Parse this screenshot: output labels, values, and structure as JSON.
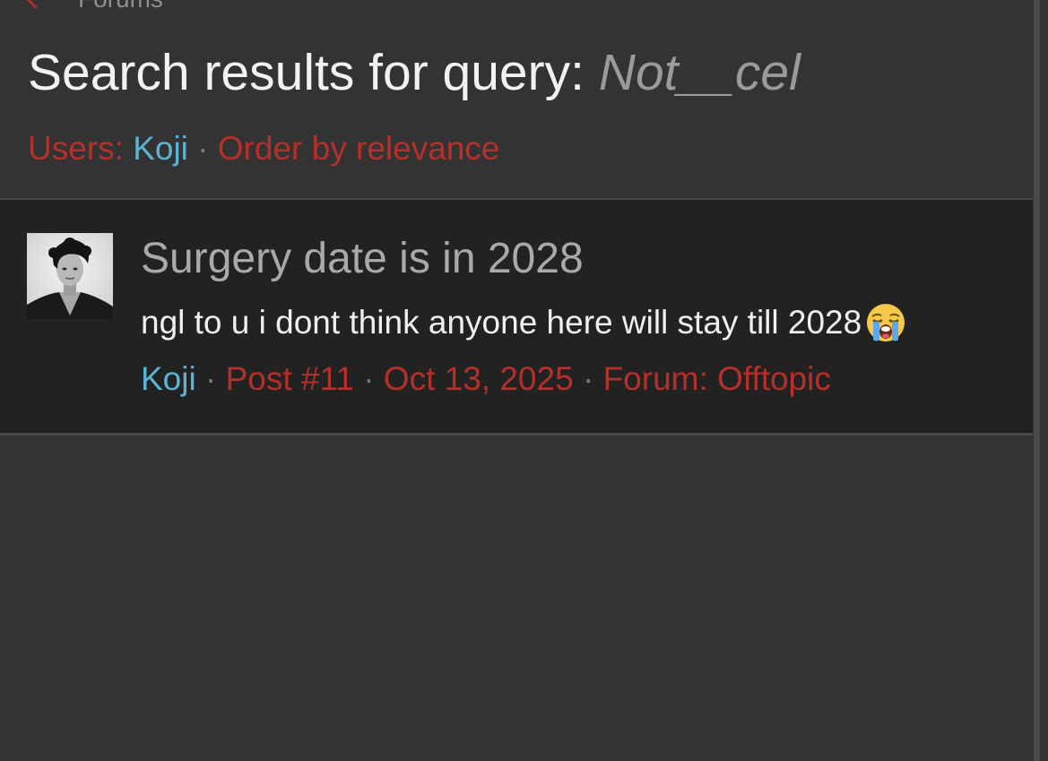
{
  "nav": {
    "back_label": "Forums"
  },
  "header": {
    "title_prefix": "Search results for query:",
    "query": "Not__cel"
  },
  "filters": {
    "users_label": "Users:",
    "user": "Koji",
    "separator": "·",
    "order": "Order by relevance"
  },
  "results": [
    {
      "title": "Surgery date is in 2028",
      "snippet": "ngl to u i dont think anyone here will stay till 2028",
      "emoji": "loudly-crying-face",
      "author": "Koji",
      "post": "Post #11",
      "date": "Oct 13, 2025",
      "forum": "Forum: Offtopic"
    }
  ],
  "colors": {
    "background": "#333333",
    "result_background": "#222222",
    "accent_red": "#b3302b",
    "link_blue": "#5cb4d4"
  }
}
